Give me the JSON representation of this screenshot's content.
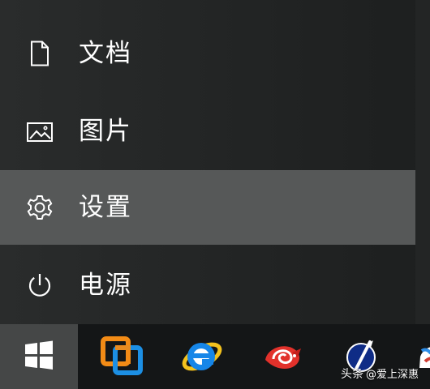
{
  "menu": {
    "items": [
      {
        "label": "文档",
        "icon": "document-icon",
        "active": false
      },
      {
        "label": "图片",
        "icon": "image-icon",
        "active": false
      },
      {
        "label": "设置",
        "icon": "gear-icon",
        "active": true
      },
      {
        "label": "电源",
        "icon": "power-icon",
        "active": false
      }
    ]
  },
  "taskbar": {
    "start_icon": "windows-logo-icon",
    "apps": [
      {
        "icon": "vmware-icon"
      },
      {
        "icon": "internet-explorer-icon"
      },
      {
        "icon": "red-shell-icon"
      },
      {
        "icon": "pen-tool-icon"
      },
      {
        "icon": "partial-app-icon"
      }
    ]
  },
  "watermark": {
    "brand": "头条",
    "text": "@爱上深惠"
  },
  "colors": {
    "menu_background": "#252727",
    "active_item_background": "#565858",
    "taskbar_background": "#141617",
    "start_button_background": "#454747",
    "text": "#ffffff"
  }
}
